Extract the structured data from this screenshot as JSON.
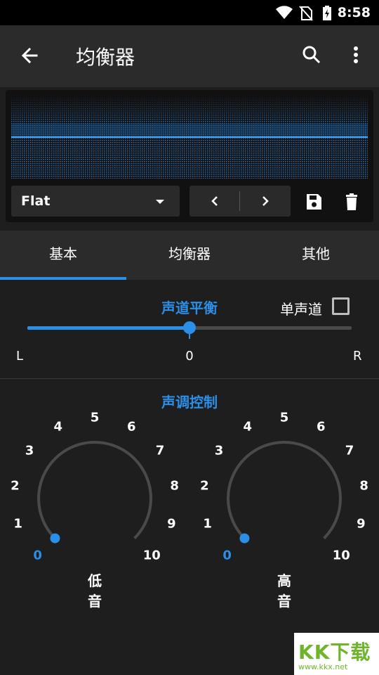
{
  "status_bar": {
    "time": "8:58",
    "icons": [
      "wifi-icon",
      "no-sim-icon",
      "battery-charging-icon"
    ]
  },
  "app_bar": {
    "title": "均衡器",
    "back_icon": "arrow-back-icon",
    "search_icon": "search-icon",
    "more_icon": "more-vert-icon"
  },
  "preset": {
    "selected": "Flat"
  },
  "toolbar": {
    "prev_icon": "chevron-left-icon",
    "next_icon": "chevron-right-icon",
    "save_icon": "save-icon",
    "delete_icon": "delete-icon"
  },
  "tabs": [
    {
      "label": "基本",
      "active": true
    },
    {
      "label": "均衡器",
      "active": false
    },
    {
      "label": "其他",
      "active": false
    }
  ],
  "balance": {
    "title": "声道平衡",
    "mono_label": "单声道",
    "mono_checked": false,
    "left_label": "L",
    "center_label": "0",
    "right_label": "R",
    "value_fraction": 0.5
  },
  "tone": {
    "title": "声调控制",
    "knobs": [
      {
        "label": "低音",
        "value": 0,
        "scale": [
          "0",
          "1",
          "2",
          "3",
          "4",
          "5",
          "6",
          "7",
          "8",
          "9",
          "10"
        ]
      },
      {
        "label": "高音",
        "value": 0,
        "scale": [
          "0",
          "1",
          "2",
          "3",
          "4",
          "5",
          "6",
          "7",
          "8",
          "9",
          "10"
        ]
      }
    ]
  },
  "colors": {
    "accent": "#2b8fe8",
    "background": "#1e1e1e",
    "bar": "#2b2b2b"
  },
  "watermark": {
    "logo": "KK下载",
    "url": "www.kkx.net"
  }
}
